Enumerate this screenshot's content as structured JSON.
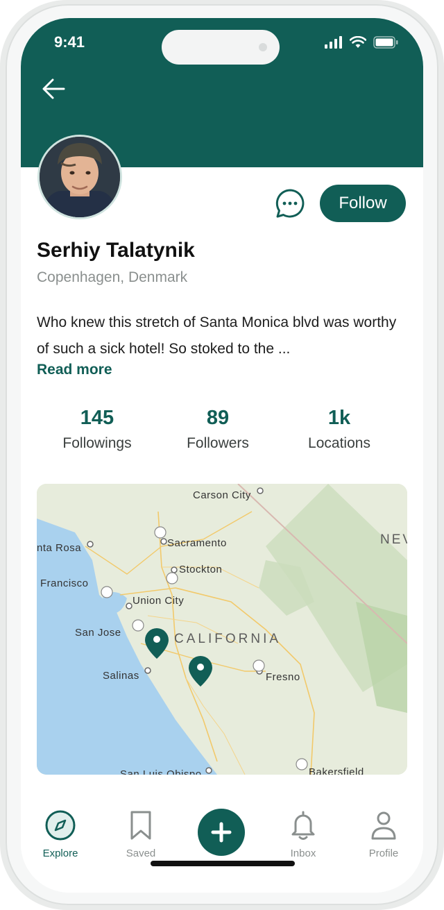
{
  "status_bar": {
    "time": "9:41"
  },
  "profile": {
    "name": "Serhiy Talatynik",
    "location": "Copenhagen, Denmark",
    "bio": "Who knew this stretch of Santa Monica blvd was worthy of such a sick hotel! So stoked to the ...",
    "read_more": "Read more",
    "follow_label": "Follow"
  },
  "stats": [
    {
      "value": "145",
      "label": "Followings"
    },
    {
      "value": "89",
      "label": "Followers"
    },
    {
      "value": "1k",
      "label": "Locations"
    }
  ],
  "map": {
    "labels": {
      "carson_city": "Carson City",
      "sacramento": "Sacramento",
      "santa_rosa": "nta Rosa",
      "stockton": "Stockton",
      "francisco": "Francisco",
      "union_city": "Union City",
      "san_jose": "San Jose",
      "california": "CALIFORNIA",
      "salinas": "Salinas",
      "fresno": "Fresno",
      "nev": "NEV",
      "san_luis_obispo": "San Luis Obispo",
      "bakersfield": "Bakersfield"
    }
  },
  "tabbar": {
    "explore": "Explore",
    "saved": "Saved",
    "inbox": "Inbox",
    "profile": "Profile"
  },
  "colors": {
    "brand": "#115e56",
    "muted": "#8a8f8e"
  },
  "icons": [
    "back-arrow-icon",
    "chat-bubble-icon",
    "map-pin-icon",
    "compass-icon",
    "bookmark-icon",
    "plus-icon",
    "bell-icon",
    "person-icon"
  ]
}
